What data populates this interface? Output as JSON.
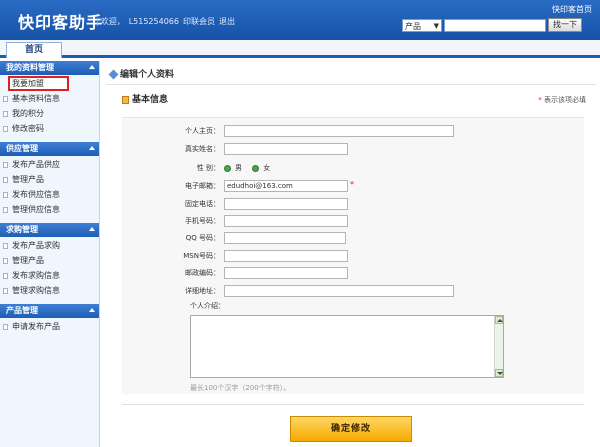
{
  "header": {
    "logo": "快印客助手",
    "welcome": "欢迎，",
    "username": "L515254066",
    "member": "印联会员",
    "logout": "退出",
    "home_link": "快印客首页",
    "search": {
      "select_value": "产品",
      "placeholder": "",
      "button": "找一下"
    }
  },
  "tabs": [
    {
      "label": "首页"
    }
  ],
  "sidebar": {
    "sections": [
      {
        "title": "我的资料管理",
        "items": [
          "我要加盟",
          "基本资料信息",
          "我的积分",
          "修改密码"
        ]
      },
      {
        "title": "供应管理",
        "items": [
          "发布产品供应",
          "管理产品",
          "发布供应信息",
          "管理供应信息"
        ]
      },
      {
        "title": "求购管理",
        "items": [
          "发布产品求购",
          "管理产品",
          "发布求购信息",
          "管理求购信息"
        ]
      },
      {
        "title": "产品管理",
        "items": [
          "申请发布产品"
        ]
      }
    ]
  },
  "main": {
    "page_title": "编辑个人资料",
    "section_title": "基本信息",
    "required_note": "表示该项必填",
    "required_star": "*",
    "form": {
      "homepage_label": "个人主页：",
      "homepage_value": "",
      "realname_label": "真实姓名：",
      "realname_value": "",
      "gender_label": "性 别：",
      "gender_male": "男",
      "gender_female": "女",
      "email_label": "电子邮箱：",
      "email_value": "edudhoi@163.com",
      "phone_label": "固定电话：",
      "phone_value": "",
      "mobile_label": "手机号码：",
      "mobile_value": "",
      "qq_label": "QQ 号码：",
      "qq_value": "",
      "msn_label": "MSN号码：",
      "msn_value": "",
      "zip_label": "邮政编码：",
      "zip_value": "",
      "address_label": "详细地址：",
      "address_value": "",
      "intro_label": "个人介绍：",
      "intro_value": "",
      "intro_hint": "最长100个汉字（200个字符）。"
    },
    "submit": "确定修改"
  },
  "colors": {
    "header_blue": "#1a5cb2",
    "sidebar_bg": "#f0f6fd",
    "active_outline": "#e02020",
    "submit_orange": "#f5a900",
    "radio_green": "#4aa44a"
  }
}
